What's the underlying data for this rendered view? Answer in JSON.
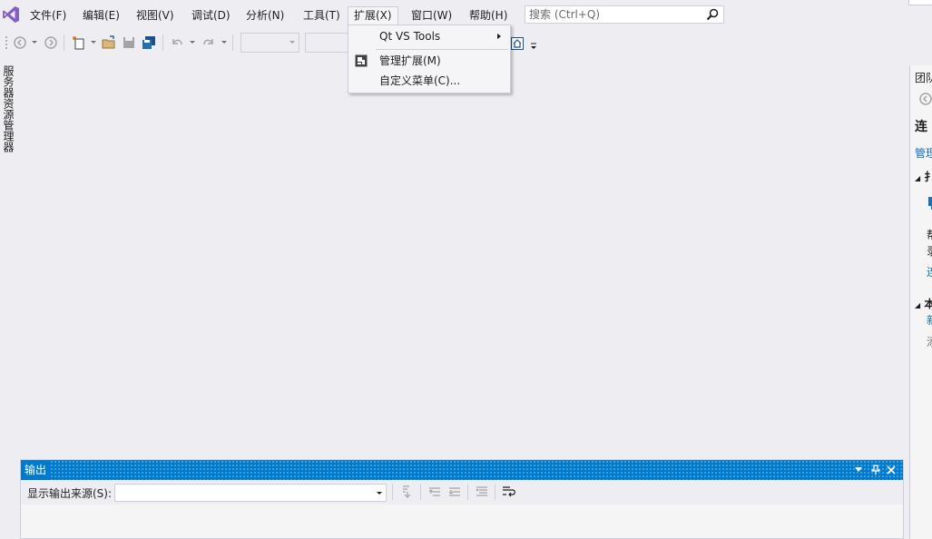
{
  "menubar": {
    "items": [
      {
        "label": "文件(F)"
      },
      {
        "label": "编辑(E)"
      },
      {
        "label": "视图(V)"
      },
      {
        "label": "调试(D)"
      },
      {
        "label": "分析(N)"
      },
      {
        "label": "工具(T)"
      },
      {
        "label": "扩展(X)"
      },
      {
        "label": "窗口(W)"
      },
      {
        "label": "帮助(H)"
      }
    ],
    "search_placeholder": "搜索 (Ctrl+Q)"
  },
  "dropdown": {
    "items": [
      {
        "label": "Qt VS Tools",
        "has_submenu": true
      },
      {
        "label": "管理扩展(M)"
      },
      {
        "label": "自定义菜单(C)..."
      }
    ]
  },
  "left_tab": {
    "label": "服务器资源管理器"
  },
  "right_panel": {
    "title": "团队",
    "heading": "连",
    "link1": "管理",
    "section1": "扌",
    "text1": "帮",
    "text2": "录",
    "link2": "连",
    "section2": "本",
    "link3": "新",
    "text3": "添"
  },
  "output": {
    "title": "输出",
    "source_label": "显示输出来源(S):",
    "source_value": ""
  },
  "colors": {
    "accent": "#007acc",
    "background": "#eeeef2",
    "logo": "#68217a"
  }
}
